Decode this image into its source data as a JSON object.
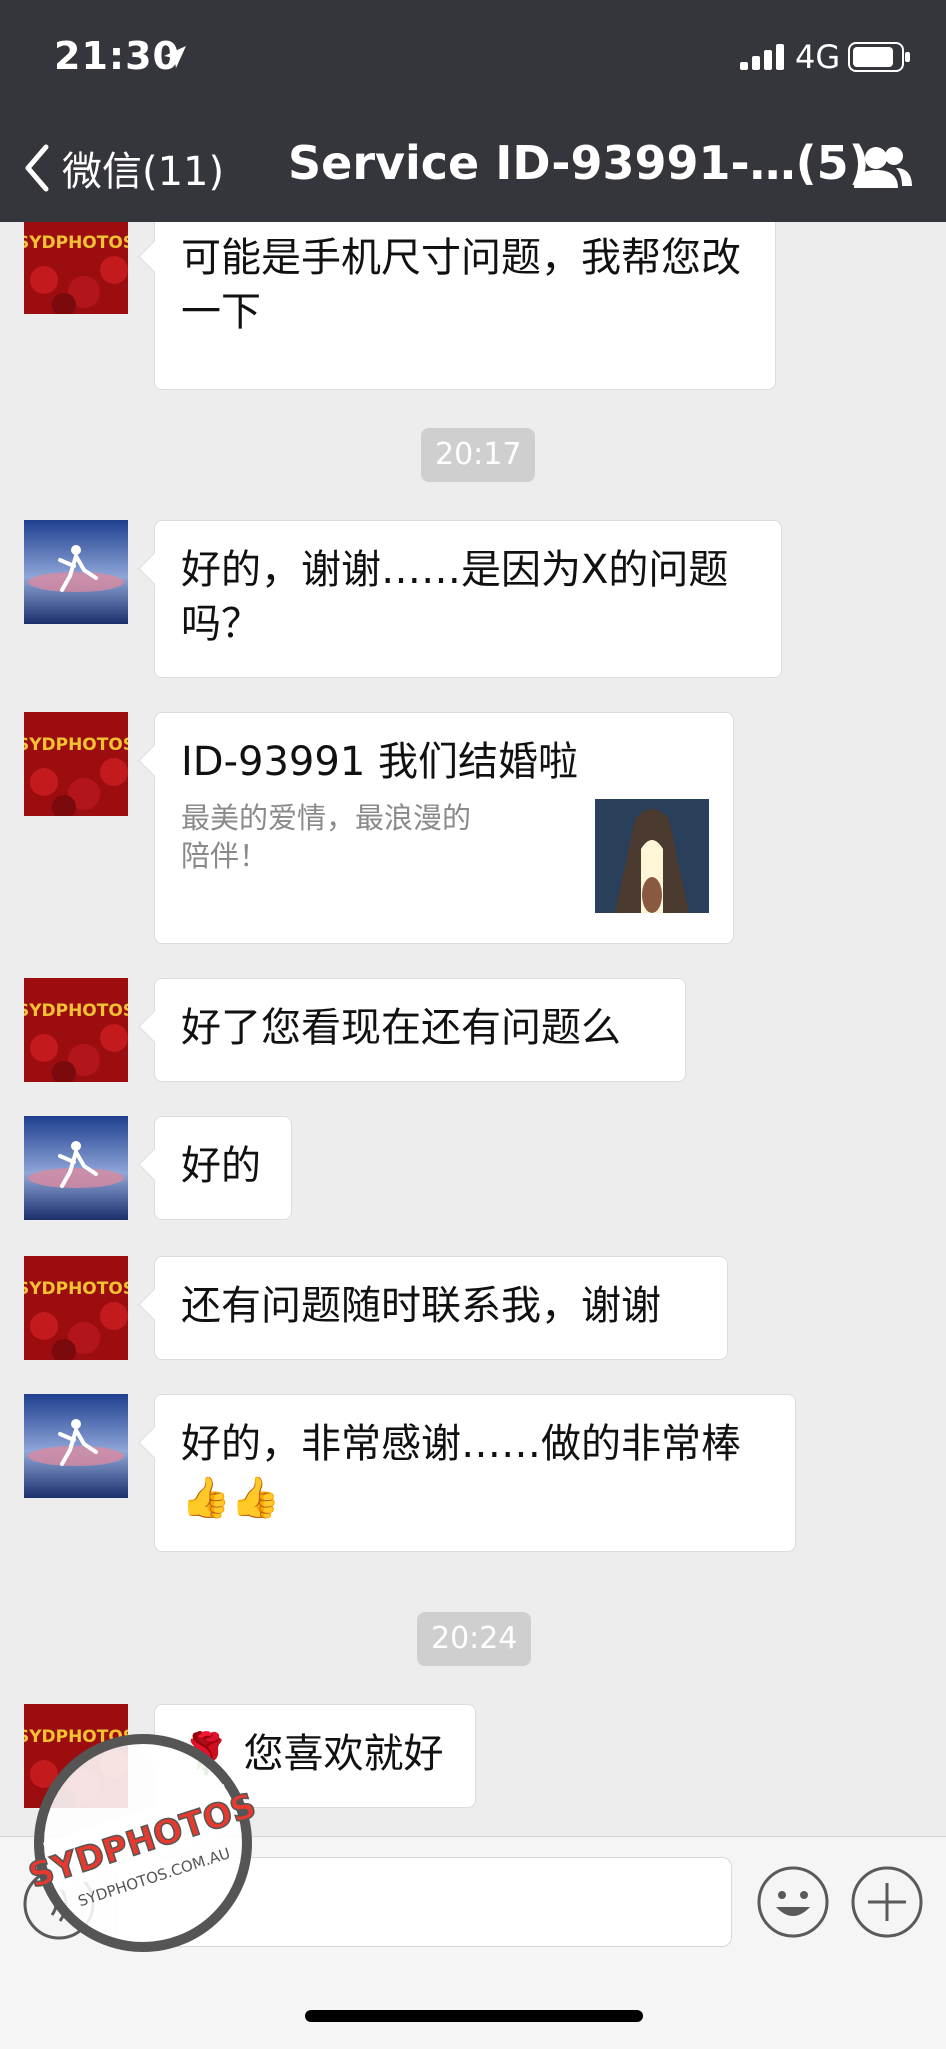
{
  "status_bar": {
    "time": "21:30",
    "network": "4G"
  },
  "nav": {
    "back_label": "微信(11)",
    "title": "Service ID-93991-…(5)"
  },
  "messages": {
    "m1": {
      "text": "可能是手机尺寸问题，我帮您改一下"
    },
    "t1": {
      "text": "20:17"
    },
    "m2": {
      "text": "好的，谢谢……是因为X的问题吗？"
    },
    "m3": {
      "title": "ID-93991 我们结婚啦",
      "desc": "最美的爱情，最浪漫的陪伴！"
    },
    "m4": {
      "text": "好了您看现在还有问题么"
    },
    "m5": {
      "text": "好的"
    },
    "m6": {
      "text": "还有问题随时联系我，谢谢"
    },
    "m7": {
      "text": "好的，非常感谢……做的非常棒",
      "emoji": "👍👍"
    },
    "t2": {
      "text": "20:24"
    },
    "m8": {
      "text": "🌹 您喜欢就好"
    }
  },
  "avatar_logo": "SYDPHOTOS",
  "watermark": {
    "brand": "SYDPHOTOS",
    "url": "SYDPHOTOS.COM.AU"
  },
  "icons": {
    "location": "location-arrow-icon",
    "signal": "signal-icon",
    "battery": "battery-icon",
    "back": "chevron-left-icon",
    "group": "people-icon",
    "voice": "voice-icon",
    "emoji": "emoji-icon",
    "plus": "plus-icon"
  },
  "colors": {
    "header": "#35363b",
    "chat_bg": "#ededed",
    "timestamp_bg": "#cfcfcf",
    "bubble": "#ffffff"
  }
}
